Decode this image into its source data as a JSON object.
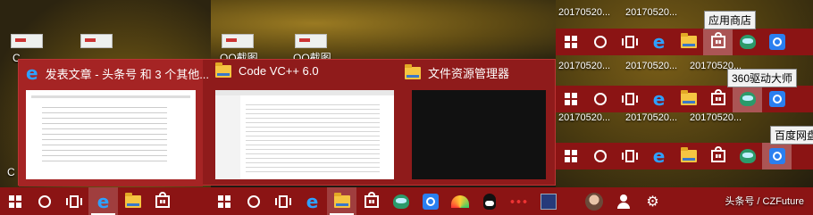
{
  "desktop": {
    "icon_labels": [
      "QQ截图",
      "QQ截图",
      "QQ截图",
      "C",
      "C"
    ],
    "timestamps": [
      "20170520...",
      "20170520...",
      "20170520...",
      "20170520...",
      "20170520...",
      "20170520...",
      "20170520...",
      "20170520..."
    ]
  },
  "switcher": {
    "windows": [
      {
        "title": "发表文章 - 头条号 和 3 个其他...",
        "icon": "edge-icon"
      },
      {
        "title": "Code VC++ 6.0",
        "icon": "folder-icon"
      },
      {
        "title": "文件资源管理器",
        "icon": "folder-icon"
      }
    ]
  },
  "tooltips": {
    "store": "应用商店",
    "driver": "360驱动大师",
    "baidu": "百度网盘"
  },
  "taskbar": {
    "accent": "#8b1414",
    "icons": [
      "windows-icon",
      "cortana-icon",
      "task-view-icon",
      "edge-icon",
      "folder-icon",
      "store-icon",
      "360-icon",
      "baidu-netdisk-icon",
      "rainbow-app-icon",
      "qq-icon",
      "dots-app-icon",
      "calculator-icon",
      "avatar-icon",
      "user-icon",
      "gear-icon"
    ]
  },
  "watermark": "头条号 / CZFuture"
}
